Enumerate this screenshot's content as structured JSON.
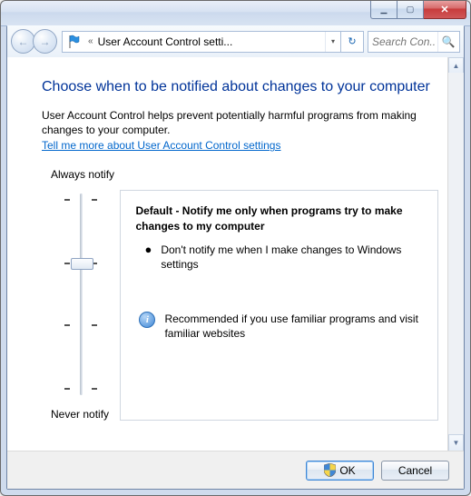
{
  "navbar": {
    "path": "User Account Control setti...",
    "search_placeholder": "Search Con..."
  },
  "heading": "Choose when to be notified about changes to your computer",
  "intro_text": "User Account Control helps prevent potentially harmful programs from making changes to your computer.",
  "more_link": "Tell me more about User Account Control settings",
  "slider": {
    "top_label": "Always notify",
    "bottom_label": "Never notify"
  },
  "description": {
    "title": "Default - Notify me only when programs try to make changes to my computer",
    "bullet": "Don't notify me when I make changes to Windows settings",
    "recommendation": "Recommended if you use familiar programs and visit familiar websites"
  },
  "buttons": {
    "ok": "OK",
    "cancel": "Cancel"
  }
}
